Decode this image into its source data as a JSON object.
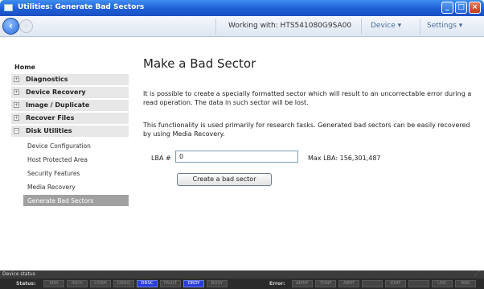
{
  "window": {
    "title": "Utilities: Generate Bad Sectors"
  },
  "toolbar": {
    "working_with": "Working with: HTS541080G9SA00",
    "device_menu": "Device ▾",
    "settings_menu": "Settings ▾"
  },
  "sidebar": {
    "home": "Home",
    "sections": [
      {
        "label": "Diagnostics",
        "expander": "+"
      },
      {
        "label": "Device Recovery",
        "expander": "+"
      },
      {
        "label": "Image / Duplicate",
        "expander": "+"
      },
      {
        "label": "Recover Files",
        "expander": "+"
      },
      {
        "label": "Disk Utilities",
        "expander": "−"
      }
    ],
    "sub_items": [
      "Device Configuration",
      "Host Protected Area",
      "Security Features",
      "Media Recovery",
      "Generate Bad Sectors"
    ]
  },
  "main": {
    "heading": "Make a Bad Sector",
    "paragraph1": "It is possible to create a specially formatted sector which will result to an uncorrectable error during a read operation. The data in such sector will be lost.",
    "paragraph2": "This functionality is used primarily for research tasks. Generated bad sectors can be easily recovered by using Media Recovery.",
    "lba_label": "LBA #",
    "lba_value": "0",
    "max_lba": "Max LBA: 156,301,487",
    "create_button": "Create a bad sector"
  },
  "status": {
    "device_status_label": "Device status",
    "status_label": "Status:",
    "status_flags": [
      "ERR",
      "INDX",
      "CORR",
      "DRRQ",
      "DRSC",
      "FAULT",
      "DRDY",
      "BUSY"
    ],
    "active_status_flags": [
      "DRSC",
      "DRDY"
    ],
    "error_label": "Error:",
    "error_flags": [
      "AMNF",
      "TONF",
      "ABRT",
      "",
      "IDNF",
      "",
      "UNC",
      "BBK"
    ]
  },
  "colors": {
    "title_blue": "#1f5fd6",
    "active_flag": "#2b3dd8",
    "selected_item": "#a0a0a0"
  }
}
